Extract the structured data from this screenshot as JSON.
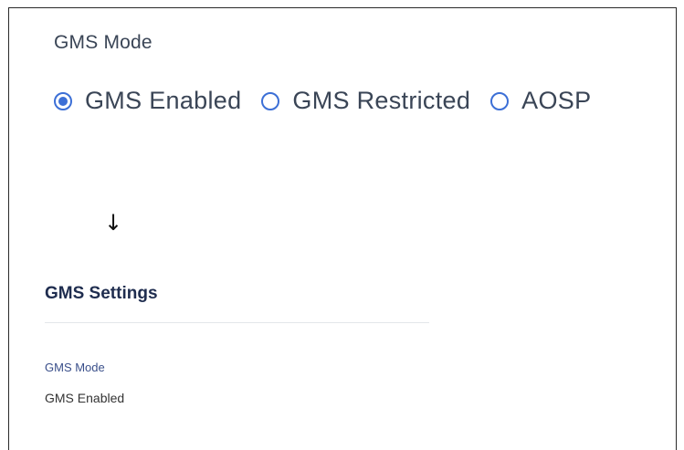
{
  "colors": {
    "accent": "#3c6fd6",
    "heading_dark": "#1f2d4f",
    "label_blue": "#3a4f8a",
    "text": "#3a4556"
  },
  "mode_picker": {
    "title": "GMS Mode",
    "options": [
      {
        "label": "GMS Enabled",
        "selected": true
      },
      {
        "label": "GMS Restricted",
        "selected": false
      },
      {
        "label": "AOSP",
        "selected": false
      }
    ]
  },
  "arrow": {
    "glyph": "↓",
    "icon": "arrow-down-icon"
  },
  "settings": {
    "title": "GMS Settings",
    "field_label": "GMS Mode",
    "field_value": "GMS Enabled"
  }
}
